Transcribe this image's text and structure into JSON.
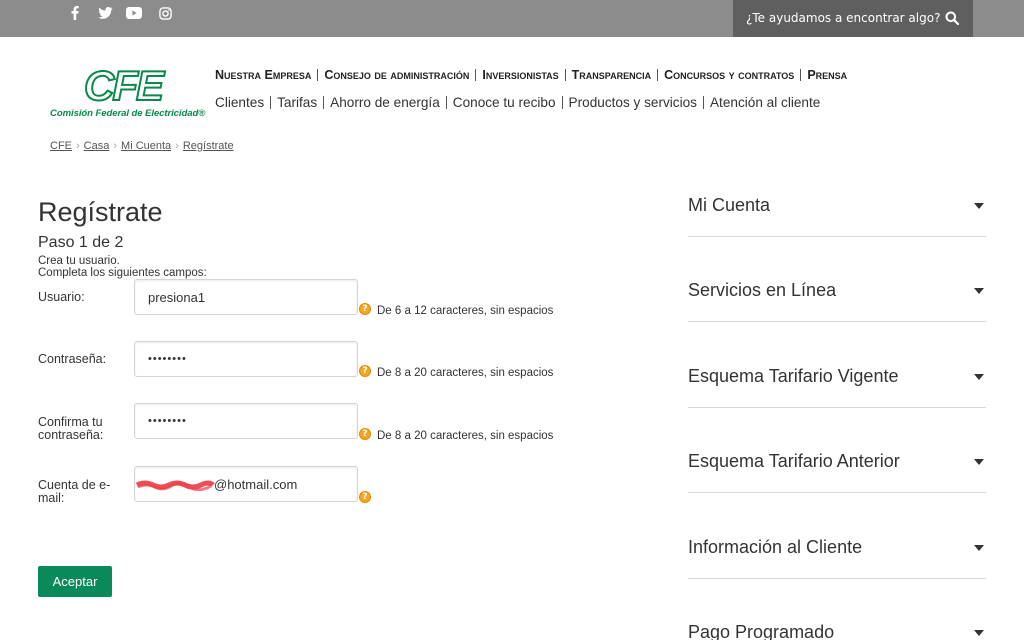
{
  "topbar": {
    "social": [
      {
        "icon": "facebook-icon"
      },
      {
        "icon": "twitter-icon"
      },
      {
        "icon": "youtube-icon"
      },
      {
        "icon": "instagram-icon"
      }
    ],
    "search_placeholder": "¿Te ayudamos a encontrar algo?",
    "search_icon": "search-icon"
  },
  "logo": {
    "mark": "CFE",
    "subtitle": "Comisión Federal de Electricidad®",
    "brand_color": "#0a8a4a"
  },
  "nav_primary": [
    "Nuestra Empresa",
    "Consejo de administración",
    "Inversionistas",
    "Transparencia",
    "Concursos y contratos",
    "Prensa"
  ],
  "nav_secondary": [
    "Clientes",
    "Tarifas",
    "Ahorro de energía",
    "Conoce tu recibo",
    "Productos y servicios",
    "Atención al cliente"
  ],
  "breadcrumb": [
    "CFE",
    "Casa",
    "Mi Cuenta",
    "Regístrate"
  ],
  "form": {
    "title": "Regístrate",
    "step": "Paso 1 de 2",
    "hint1": "Crea tu usuario.",
    "hint2": "Completa los siguientes campos:",
    "fields": [
      {
        "label": "Usuario:",
        "value": "presiona1",
        "help": "De 6 a 12 caracteres, sin espacios"
      },
      {
        "label": "Contraseña:",
        "value": "••••••••",
        "help": "De 8 a 20 caracteres, sin espacios"
      },
      {
        "label": "Confirma tu contraseña:",
        "value": "••••••••",
        "help": "De 8 a 20 caracteres, sin espacios"
      },
      {
        "label": "Cuenta de e-mail:",
        "value": "@hotmail.com",
        "help": ""
      }
    ],
    "submit_label": "Aceptar",
    "accent_color": "#0a8a5a"
  },
  "sidebar": [
    {
      "label": "Mi Cuenta"
    },
    {
      "label": "Servicios en Línea"
    },
    {
      "label": "Esquema Tarifario Vigente"
    },
    {
      "label": "Esquema Tarifario Anterior"
    },
    {
      "label": "Información al Cliente"
    },
    {
      "label": "Pago Programado"
    }
  ]
}
